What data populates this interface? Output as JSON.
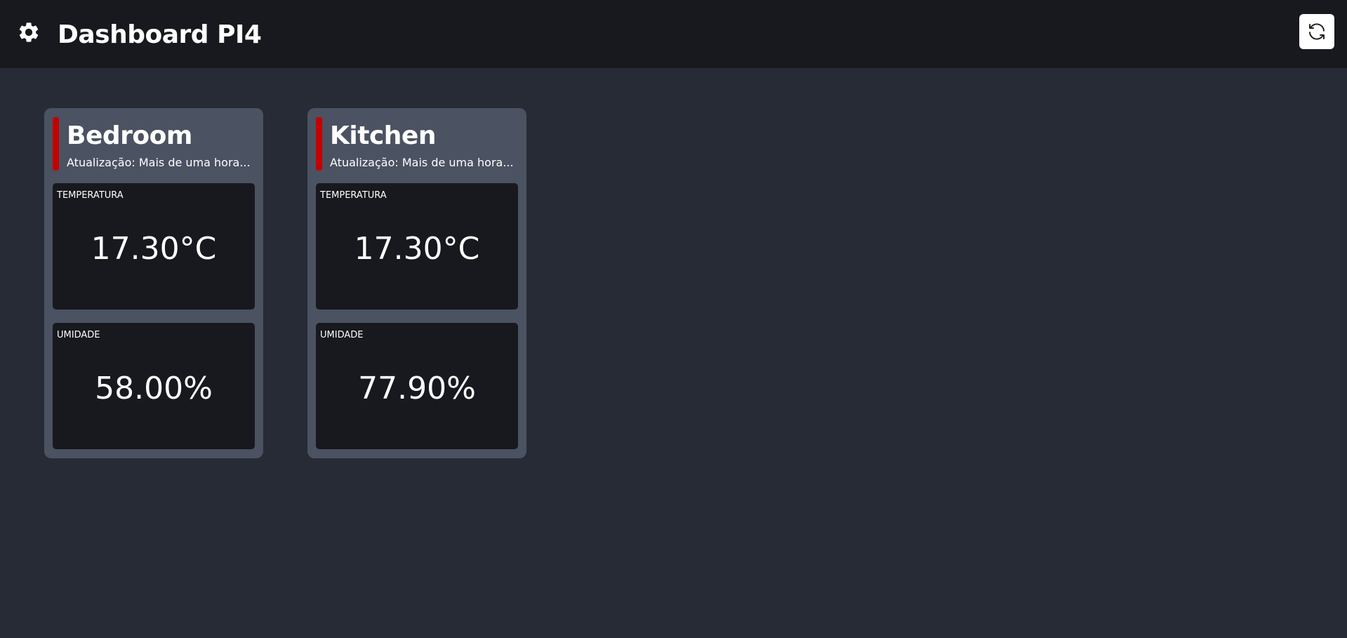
{
  "header": {
    "title": "Dashboard PI4",
    "settings_icon": "gear-icon",
    "refresh_icon": "refresh-icon"
  },
  "colors": {
    "background": "#272b35",
    "topbar": "#18191e",
    "card": "#4b5261",
    "metric_panel": "#18191e",
    "status_stale": "#c40000"
  },
  "rooms": [
    {
      "name": "Bedroom",
      "update": "Atualização: Mais de uma hora...",
      "metrics": [
        {
          "label": "TEMPERATURA",
          "value": "17.30°C"
        },
        {
          "label": "UMIDADE",
          "value": "58.00%"
        }
      ]
    },
    {
      "name": "Kitchen",
      "update": "Atualização: Mais de uma hora...",
      "metrics": [
        {
          "label": "TEMPERATURA",
          "value": "17.30°C"
        },
        {
          "label": "UMIDADE",
          "value": "77.90%"
        }
      ]
    }
  ]
}
